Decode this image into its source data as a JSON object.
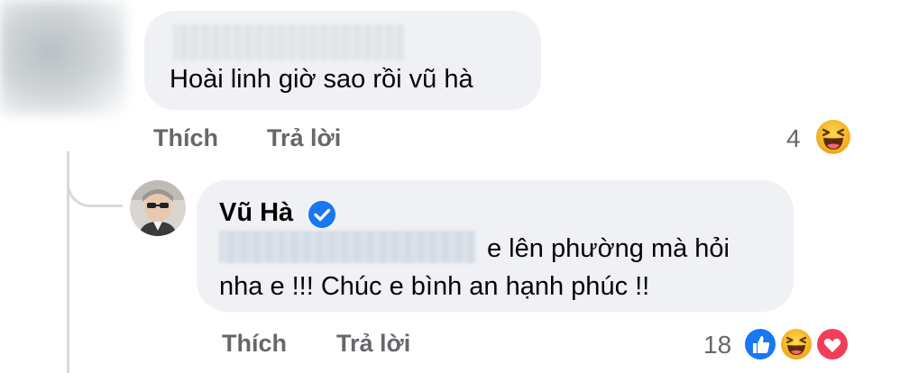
{
  "comment1": {
    "text": "Hoài linh giờ sao rồi vũ hà",
    "actions": {
      "like_label": "Thích",
      "reply_label": "Trả lời"
    },
    "reaction_count": "4",
    "reactions": [
      "haha-icon"
    ]
  },
  "reply": {
    "author": "Vũ Hà",
    "verified": true,
    "text_line1": "e lên phường mà hỏi",
    "text_line2": "nha e !!! Chúc e bình an hạnh phúc !!",
    "actions": {
      "like_label": "Thích",
      "reply_label": "Trả lời"
    },
    "reaction_count": "18",
    "reactions": [
      "like-icon",
      "haha-icon",
      "love-icon"
    ]
  },
  "colors": {
    "bubble": "#eff1f4",
    "action_text": "#65676b",
    "verified_blue": "#1877f2",
    "like_blue": "#1877f2",
    "haha_yellow": "#f7b125",
    "love_red": "#f33e58"
  }
}
